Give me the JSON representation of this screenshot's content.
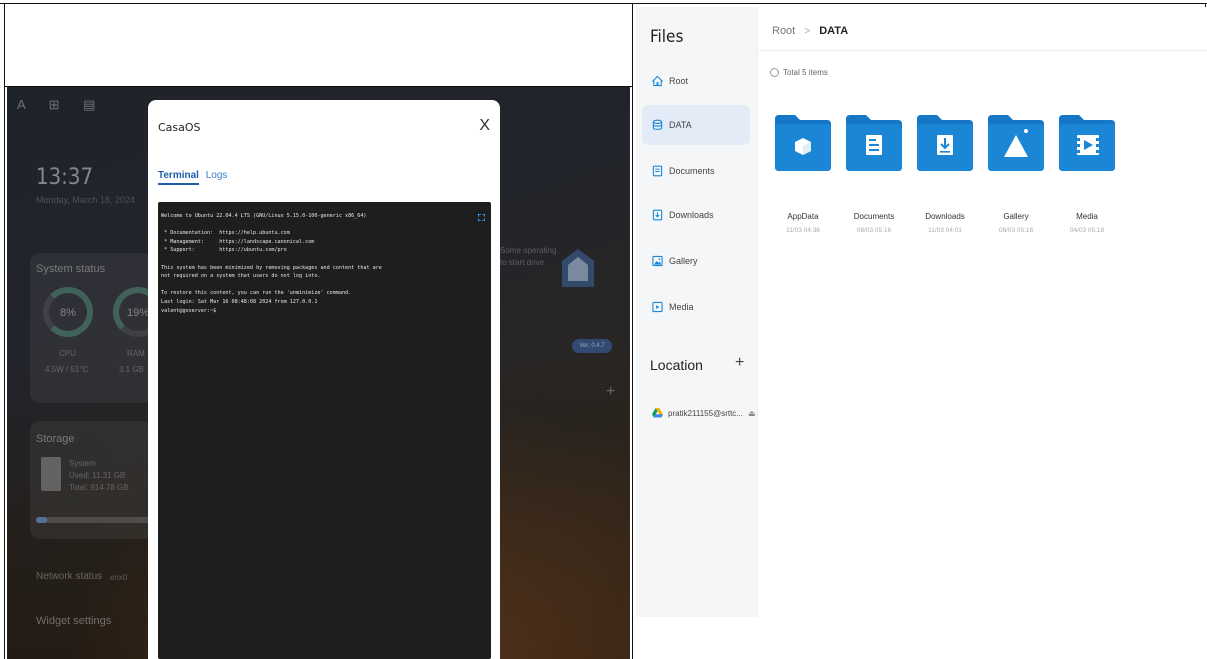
{
  "dashboard": {
    "top_icons": "A ⊞ ▤",
    "clock": "13:37",
    "date": "Monday, March 18, 2024",
    "system_status": "System status",
    "gauges": [
      {
        "value": "8%",
        "label": "CPU",
        "sub": "4.5W / 51°C"
      },
      {
        "value": "19%",
        "label": "RAM",
        "sub": "3.1 GB"
      }
    ],
    "storage_title": "Storage",
    "storage_lines": [
      "System",
      "Used: 11.31 GB",
      "Total: 914.78 GB"
    ],
    "storage_fraction": 0.1,
    "network_status": "Network status",
    "network_iface": "enx0",
    "widget_settings": "Widget settings",
    "app_tip": [
      "Some operating",
      "to start drive"
    ],
    "version_badge": "Ver. 0.4.7"
  },
  "modal": {
    "title": "CasaOS",
    "close": "X",
    "tabs": [
      {
        "label": "Terminal",
        "active": true
      },
      {
        "label": "Logs",
        "active": false
      }
    ],
    "terminal_lines": [
      "Welcome to Ubuntu 22.04.4 LTS (GNU/Linux 5.15.0-100-generic x86_64)",
      "",
      " * Documentation:  https://help.ubuntu.com",
      " * Management:     https://landscape.canonical.com",
      " * Support:        https://ubuntu.com/pro",
      "",
      "This system has been minimized by removing packages and content that are",
      "not required on a system that users do not log into.",
      "",
      "To restore this content, you can run the 'unminimize' command.",
      "Last login: Sat Mar 16 08:48:08 2024 from 127.0.0.1",
      "valent@goserver:~$"
    ]
  },
  "files": {
    "title": "Files",
    "sidebar": [
      {
        "label": "Root",
        "icon": "home-icon"
      },
      {
        "label": "DATA",
        "icon": "database-icon",
        "active": true
      },
      {
        "label": "Documents",
        "icon": "document-icon"
      },
      {
        "label": "Downloads",
        "icon": "download-icon"
      },
      {
        "label": "Gallery",
        "icon": "image-icon"
      },
      {
        "label": "Media",
        "icon": "film-icon"
      }
    ],
    "location_title": "Location",
    "location_add": "+",
    "location_item": "pratik211155@srttc...",
    "location_eject": "⏏",
    "breadcrumb": {
      "root": "Root",
      "sep": ">",
      "current": "DATA"
    },
    "total": "Total 5 items",
    "folders": [
      {
        "name": "AppData",
        "date": "11/03 04:36",
        "badge": "cube",
        "color": "#1b86d6"
      },
      {
        "name": "Documents",
        "date": "08/03 05:16",
        "badge": "doc",
        "color": "#1b86d6"
      },
      {
        "name": "Downloads",
        "date": "11/03 04:01",
        "badge": "download",
        "color": "#1b86d6"
      },
      {
        "name": "Gallery",
        "date": "08/03 05:16",
        "badge": "mountain",
        "color": "#1b86d6"
      },
      {
        "name": "Media",
        "date": "04/03 05:18",
        "badge": "film",
        "color": "#1b86d6"
      }
    ]
  }
}
